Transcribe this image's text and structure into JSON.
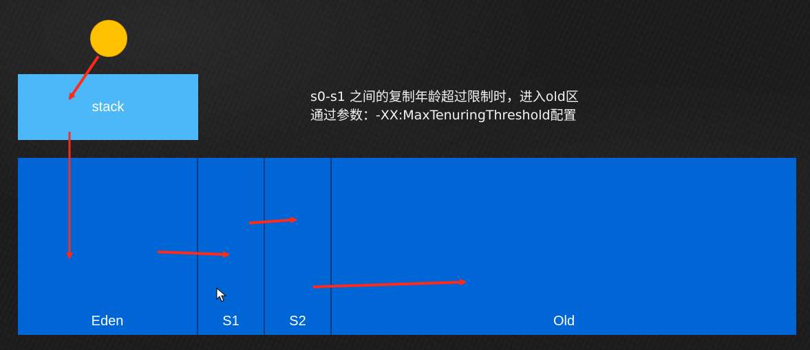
{
  "diagram": {
    "stack_label": "stack",
    "note_lines": [
      "s0-s1 之间的复制年龄超过限制时，进入old区",
      "通过参数：-XX:MaxTenuringThreshold配置"
    ],
    "regions": {
      "eden": "Eden",
      "s1": "S1",
      "s2": "S2",
      "old": "Old"
    }
  },
  "colors": {
    "object": "#ffc000",
    "stack": "#4db8f7",
    "heap": "#0066d6",
    "arrow": "#ff2a1a",
    "text": "#ffffff"
  }
}
